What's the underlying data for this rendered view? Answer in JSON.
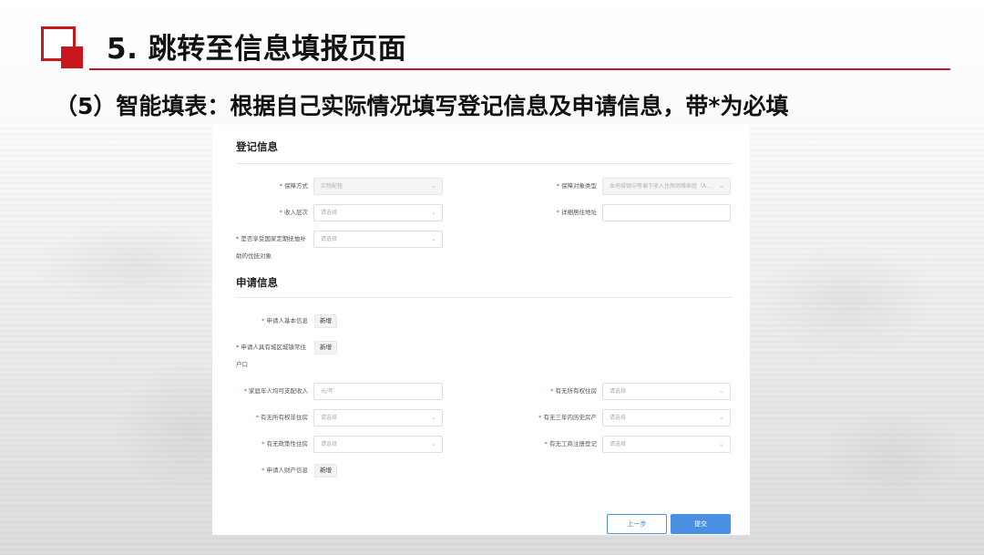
{
  "slide": {
    "title": "5. 跳转至信息填报页面",
    "subtitle": "（5）智能填表：根据自己实际情况填写登记信息及申请信息，带*为必填"
  },
  "form": {
    "required_mark": "*",
    "registration": {
      "title": "登记信息",
      "security_method": {
        "label": "保障方式",
        "value": "实物配租"
      },
      "security_target_type": {
        "label": "保障对象类型",
        "value": "本地城镇中等偏下收入住房困难家庭（A…"
      },
      "income_level": {
        "label": "收入层次",
        "placeholder": "请选择"
      },
      "detailed_address": {
        "label": "详细居住地址",
        "value": ""
      },
      "rescue_target": {
        "label_line1": "是否享受国家定期抚恤补",
        "label_line2": "助的优抚对象",
        "placeholder": "请选择"
      }
    },
    "application": {
      "title": "申请信息",
      "applicant_basic": {
        "label": "申请人基本信息",
        "button": "新增"
      },
      "applicant_household": {
        "label_line1": "申请人具有城区城镇常住",
        "label_line2": "户口",
        "button": "新增"
      },
      "family_income": {
        "label": "家庭年人均可支配收入",
        "placeholder": "元/年"
      },
      "own_property": {
        "label": "有无所有权住房",
        "placeholder": "请选择"
      },
      "own_title_housing": {
        "label": "有无所有权非住房",
        "placeholder": "请选择"
      },
      "three_year_history": {
        "label": "有无三年内历史房产",
        "placeholder": "请选择"
      },
      "policy_housing": {
        "label": "有无政策性住房",
        "placeholder": "请选择"
      },
      "business_registration": {
        "label": "有无工商注册登记",
        "placeholder": "请选择"
      },
      "applicant_assets": {
        "label": "申请人财产信息",
        "button": "新增"
      }
    },
    "actions": {
      "prev": "上一步",
      "submit": "提交"
    }
  },
  "colors": {
    "accent_red": "#c8161e",
    "primary_blue": "#4a90e2"
  },
  "icons": {
    "select_arrow": "chevron-down-icon"
  }
}
